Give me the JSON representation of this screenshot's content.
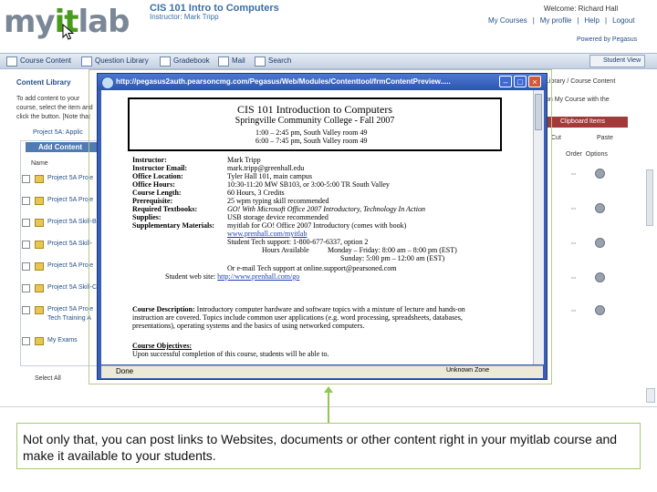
{
  "header": {
    "logo_prefix": "my",
    "logo_it": "it",
    "logo_suffix": "lab",
    "course_title": "CIS 101 Intro to Computers",
    "instructor": "Instructor: Mark Tripp",
    "welcome": "Welcome: Richard Hall",
    "links": [
      "My Courses",
      "|",
      "My profile",
      "|",
      "Help",
      "|",
      "Logout"
    ],
    "powered_by": "Powered by Pegasus"
  },
  "tabs": [
    "Course Content",
    "Question Library",
    "Gradebook",
    "Mail",
    "Search"
  ],
  "student_view": "Student View",
  "content_library": {
    "title": "Content Library",
    "intro_text": "To add content to your course, select the item and click the button. [Note that folders contents will be added to your course.]",
    "top_item": "Project 5A: Applic",
    "add_content": "Add Content",
    "name_header": "Name",
    "rows": [
      "Project 5A Proje",
      "Project 5A Proje",
      "Project 5A Skill-B",
      "Project 5A Skill-",
      "Project 5A Proje",
      "Project 5A Skill-C",
      "Project 5A Proje",
      "Tech Training A",
      "My Exams"
    ],
    "select_all": "Select All"
  },
  "right_panel": {
    "text1": "Library / Course Content",
    "text2": "on My Course with the",
    "clipboard": "Clipboard Items",
    "cut": "Cut",
    "paste": "Paste",
    "order": "Order",
    "options": "Options"
  },
  "popup": {
    "url": "http://pegasus2auth.pearsoncmg.com/Pegasus/Web/Modules/Contenttool/frmContentPreview.....",
    "status_done": "Done",
    "status_zone": "Unknown Zone",
    "syllabus": {
      "title1": "CIS 101 Introduction to Computers",
      "title2": "Springville Community College - Fall 2007",
      "time1": "1:00 – 2:45 pm, South Valley room 49",
      "time2": "6:00 – 7:45 pm, South Valley room 49",
      "fields": [
        {
          "label": "Instructor:",
          "value": "Mark Tripp"
        },
        {
          "label": "Instructor Email:",
          "value": "mark.tripp@greenhall.edu"
        },
        {
          "label": "Office Location:",
          "value": "Tyler Hall 101, main campus"
        },
        {
          "label": "Office Hours:",
          "value": "10:30-11:20 MW SB103, or 3:00-5:00 TR South Valley"
        },
        {
          "label": "Course Length:",
          "value": "60 Hours, 3 Credits"
        },
        {
          "label": "Prerequisite:",
          "value": "25 wpm typing skill recommended"
        },
        {
          "label": "Required Textbooks:",
          "value": "GO! With Microsoft Office 2007 Introductory, Technology In Action"
        },
        {
          "label": "Supplies:",
          "value": "USB storage device recommended"
        },
        {
          "label": "Supplementary Materials:",
          "value": "myitlab for GO! Office 2007 Introductory (comes with book)"
        }
      ],
      "link1": "www.prenhall.com/myitlab",
      "support": "Student Tech support: 1-800-677-6337, option 2",
      "hours_label": "Hours Available",
      "hours1": "Monday – Friday:  8:00 am – 8:00 pm (EST)",
      "hours2": "Sunday:  5:00 pm – 12:00 am (EST)",
      "email_support": "Or e-mail Tech support at online.support@pearsoned.com",
      "website_label": "Student web site:",
      "website": "http://www.prenhall.com/go",
      "desc_label": "Course Description:",
      "desc": "Introductory computer hardware and software topics with a mixture of lecture and hands-on instruction are covered. Topics include common user applications (e.g. word processing, spreadsheets, databases, presentations), operating systems and the basics of using networked computers.",
      "obj_label": "Course Objectives:",
      "obj": "Upon successful completion of this course, students will be able to."
    }
  },
  "caption": "Not only that, you can post links to Websites, documents or other content right in your myitlab course and make it available to your students.",
  "colors": {
    "accent_green": "#90c850",
    "brand_blue": "#25528a",
    "clipboard_red": "#a33a3a"
  }
}
